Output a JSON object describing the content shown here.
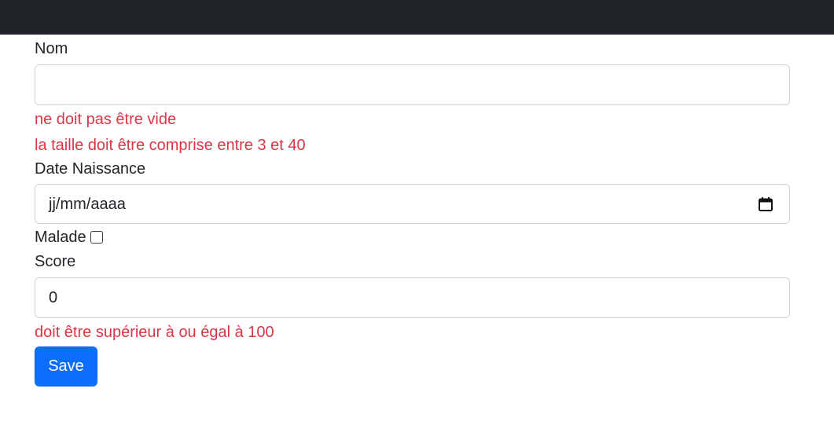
{
  "form": {
    "nom_label": "Nom",
    "nom_value": "",
    "nom_errors": [
      "ne doit pas être vide",
      "la taille doit être comprise entre 3 et 40"
    ],
    "date_label": "Date Naissance",
    "date_value": "jj/mm/aaaa",
    "malade_label": "Malade",
    "malade_checked": false,
    "score_label": "Score",
    "score_value": "0",
    "score_error": "doit être supérieur à ou égal à 100",
    "save_label": "Save"
  },
  "colors": {
    "navbar": "#212529",
    "error": "#dc3545",
    "primary": "#0d6efd"
  },
  "icons": {
    "date": "calendar-icon"
  }
}
